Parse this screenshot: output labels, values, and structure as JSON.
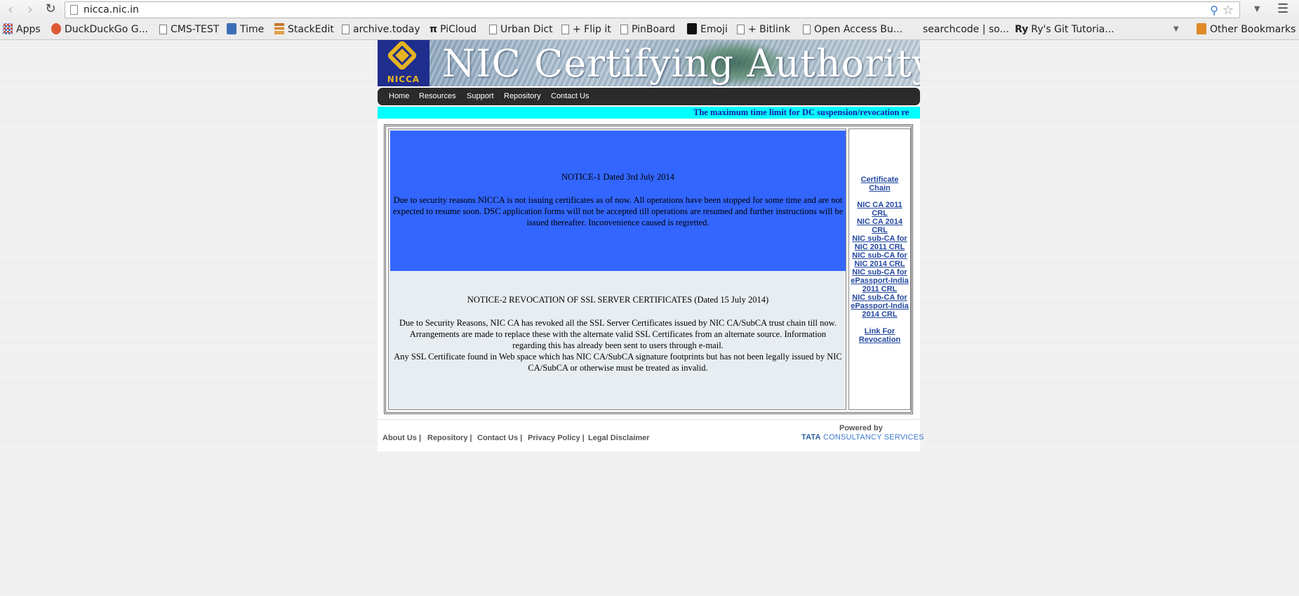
{
  "browser": {
    "url": "nicca.nic.in",
    "bookmarks": [
      {
        "label": "Apps",
        "icon": "apps-grid-icon"
      },
      {
        "label": "DuckDuckGo G...",
        "icon": "duckduckgo-icon"
      },
      {
        "label": "CMS-TEST",
        "icon": "page-icon"
      },
      {
        "label": "Time",
        "icon": "time-icon"
      },
      {
        "label": "StackEdit",
        "icon": "stackedit-icon"
      },
      {
        "label": "archive.today",
        "icon": "page-icon"
      },
      {
        "label": "PiCloud",
        "icon": "pi-icon"
      },
      {
        "label": "Urban Dict",
        "icon": "page-icon"
      },
      {
        "label": "+ Flip it",
        "icon": "page-icon"
      },
      {
        "label": "PinBoard",
        "icon": "page-icon"
      },
      {
        "label": "Emoji",
        "icon": "emoji-icon"
      },
      {
        "label": "+ Bitlink",
        "icon": "page-icon"
      },
      {
        "label": "Open Access Bu...",
        "icon": "page-icon"
      },
      {
        "label": "searchcode | so...",
        "icon": "none"
      },
      {
        "label": "Ry's Git Tutoria...",
        "icon": "ry-icon"
      }
    ],
    "other_bookmarks": "Other Bookmarks"
  },
  "site": {
    "banner_title": "NIC Certifying Authority",
    "logo_text": "NICCA",
    "nav": [
      "Home",
      "Resources",
      "Support",
      "Repository",
      "Contact Us"
    ],
    "ticker": "The maximum time limit for DC suspension/revocation re",
    "notice1": {
      "title": "NOTICE-1 Dated 3rd July 2014",
      "body": "Due to security reasons NICCA is not issuing certificates as of now. All operations have been stopped for some time and are not expected to resume soon. DSC application forms will not be accepted till operations are resumed and further instructions will be issued thereafter. Inconvenience caused is regretted."
    },
    "notice2": {
      "title": "NOTICE-2 REVOCATION OF SSL SERVER CERTIFICATES (Dated 15 July 2014)",
      "body1": "Due to Security Reasons, NIC CA has revoked all the SSL Server Certificates issued by NIC CA/SubCA trust chain till now. Arrangements are made to replace these with the alternate valid SSL Certificates from an alternate source. Information regarding this has already been sent to users through e-mail.",
      "body2": "Any SSL Certificate found in Web space which has NIC CA/SubCA signature footprints but has not been legally issued by NIC CA/SubCA or otherwise must be treated as invalid."
    },
    "side_links": [
      "Certificate Chain",
      "NIC CA 2011 CRL",
      "NIC CA 2014 CRL",
      "NIC sub-CA for NIC 2011 CRL",
      "NIC sub-CA for NIC 2014 CRL",
      "NIC sub-CA for ePassport-India 2011 CRL",
      "NIC sub-CA for ePassport-India 2014 CRL",
      "Link For Revocation"
    ],
    "footer": {
      "links": [
        "About Us |",
        "Repository |",
        "Contact Us |",
        "Privacy Policy |",
        "Legal Disclaimer"
      ],
      "powered_by": "Powered by",
      "tcs_brand": "TATA",
      "tcs_name": "CONSULTANCY SERVICES"
    }
  },
  "colors": {
    "notice1_bg": "#3366ff",
    "ticker_bg": "#00ffff",
    "ticker_text": "#1a1aa8",
    "link": "#2448a0",
    "navbar_bg": "#2b2b2b"
  }
}
